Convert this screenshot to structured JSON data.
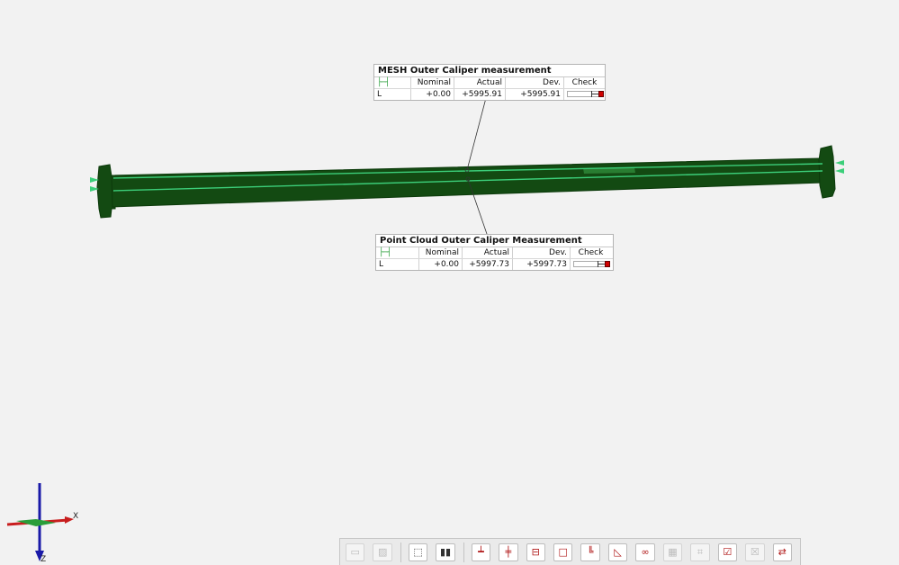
{
  "mesh_table": {
    "title": "MESH Outer Caliper measurement",
    "icon": "caliper-icon",
    "headers": {
      "nominal": "Nominal",
      "actual": "Actual",
      "dev": "Dev.",
      "check": "Check"
    },
    "row": {
      "label": "L",
      "nominal": "+0.00",
      "actual": "+5995.91",
      "dev": "+5995.91"
    }
  },
  "cloud_table": {
    "title": "Point Cloud Outer Caliper Measurement",
    "icon": "caliper-icon",
    "headers": {
      "nominal": "Nominal",
      "actual": "Actual",
      "dev": "Dev.",
      "check": "Check"
    },
    "row": {
      "label": "L",
      "nominal": "+0.00",
      "actual": "+5997.73",
      "dev": "+5997.73"
    }
  },
  "axes": {
    "x_label": "X",
    "z_label": "Z"
  },
  "colors": {
    "shaft": "#134a12",
    "shaft_edge": "#0c3a0b",
    "measure_line": "#3ccf7a",
    "x_axis": "#c81e1e",
    "y_axis": "#2a9d3a",
    "z_axis": "#1a1aa8",
    "check_fail": "#d00000"
  },
  "toolbar": {
    "groups": [
      [
        "view-icon",
        "hatch-icon"
      ],
      [
        "select-icon",
        "split-icon"
      ],
      [
        "plane-icon",
        "center-plane-icon",
        "cylinder-icon",
        "box-icon",
        "corner-icon",
        "angle-icon",
        "circles-icon",
        "grid-icon",
        "frame-icon",
        "check-icon",
        "cancel-icon",
        "transform-icon"
      ]
    ]
  }
}
